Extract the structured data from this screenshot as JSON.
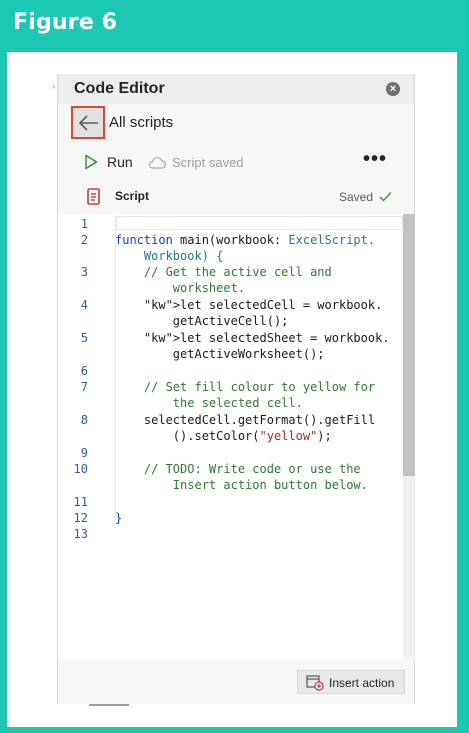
{
  "figure": {
    "title": "Figure 6"
  },
  "editor": {
    "title": "Code Editor",
    "nav_label": "All scripts",
    "toolbar": {
      "run_label": "Run",
      "save_status": "Script saved",
      "more_label": "•••"
    },
    "script": {
      "name": "Script",
      "state": "Saved"
    },
    "code": {
      "line_numbers": [
        "1",
        "2",
        "3",
        "4",
        "5",
        "6",
        "7",
        "8",
        "9",
        "10",
        "11",
        "12",
        "13"
      ],
      "lines": [
        "",
        "function main(workbook: ExcelScript.",
        "    Workbook) {",
        "    // Get the active cell and",
        "        worksheet.",
        "    let selectedCell = workbook.",
        "        getActiveCell();",
        "    let selectedSheet = workbook.",
        "        getActiveWorksheet();",
        "",
        "    // Set fill colour to yellow for",
        "        the selected cell.",
        "    selectedCell.getFormat().getFill",
        "        ().setColor(\"yellow\");",
        "",
        "    // TODO: Write code or use the",
        "        Insert action button below.",
        "",
        "}",
        ""
      ]
    },
    "insert_action_label": "Insert action"
  },
  "colors": {
    "background": "#1cc8b4",
    "highlight": "#e4432d",
    "keyword": "#0b3fcf",
    "comment": "#2f7a2f"
  }
}
